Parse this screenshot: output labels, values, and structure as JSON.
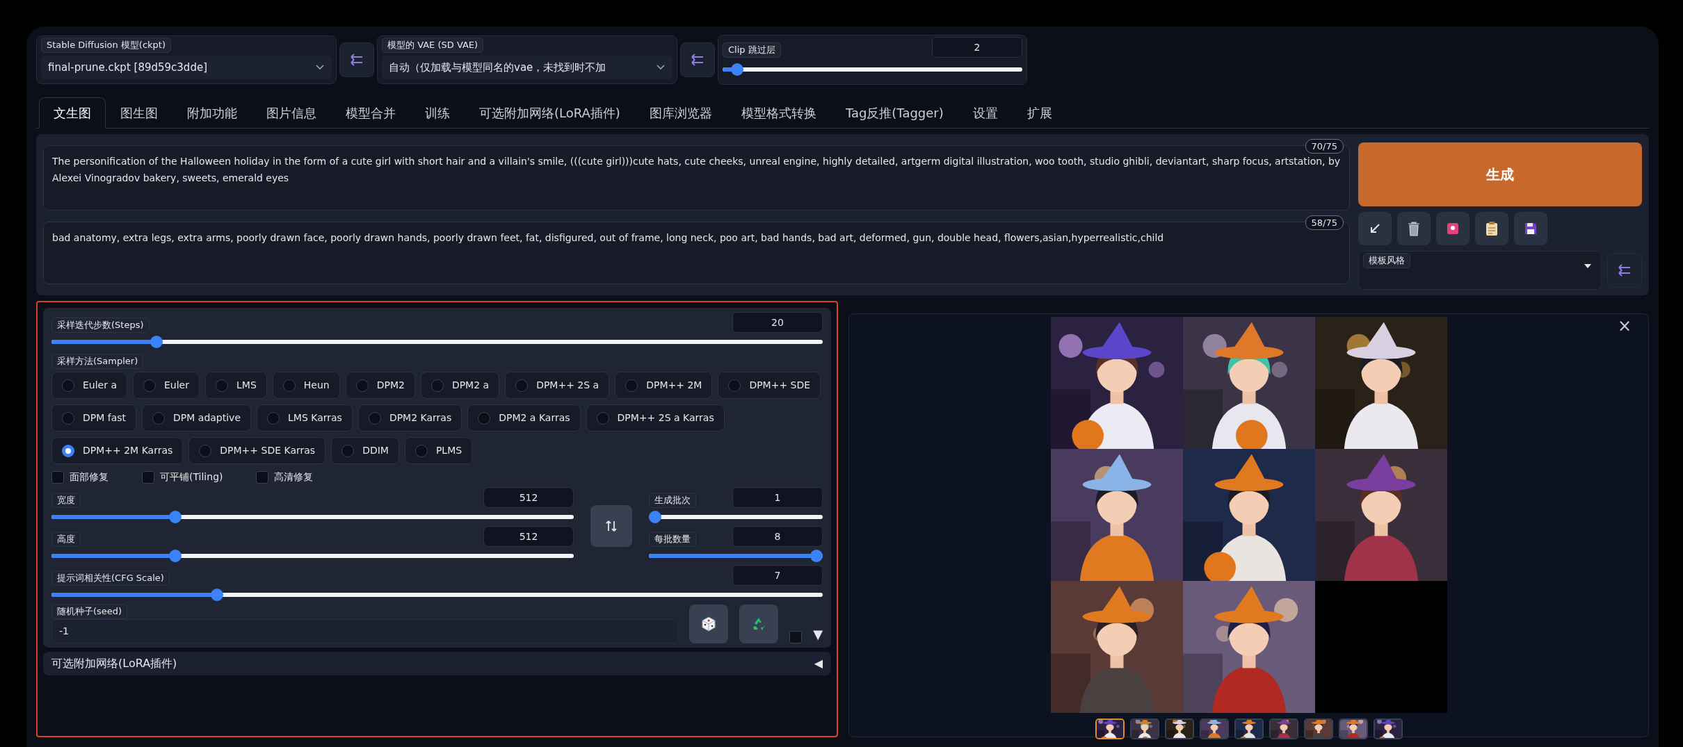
{
  "top_bar": {
    "checkpoint": {
      "label": "Stable Diffusion 模型(ckpt)",
      "value": "final-prune.ckpt [89d59c3dde]"
    },
    "vae": {
      "label": "模型的 VAE (SD VAE)",
      "value": "自动（仅加载与模型同名的vae，未找到时不加"
    },
    "clip_skip": {
      "label": "Clip 跳过层",
      "value": "2",
      "level": 0.03
    }
  },
  "tabs": [
    {
      "label": "文生图",
      "selected": true
    },
    {
      "label": "图生图",
      "selected": false
    },
    {
      "label": "附加功能",
      "selected": false
    },
    {
      "label": "图片信息",
      "selected": false
    },
    {
      "label": "模型合并",
      "selected": false
    },
    {
      "label": "训练",
      "selected": false
    },
    {
      "label": "可选附加网络(LoRA插件)",
      "selected": false
    },
    {
      "label": "图库浏览器",
      "selected": false
    },
    {
      "label": "模型格式转换",
      "selected": false
    },
    {
      "label": "Tag反推(Tagger)",
      "selected": false
    },
    {
      "label": "设置",
      "selected": false
    },
    {
      "label": "扩展",
      "selected": false
    }
  ],
  "prompt": {
    "text": "The personification of the Halloween holiday in the form of a cute girl with short hair and a villain's smile, (((cute girl)))cute hats, cute cheeks, unreal engine, highly detailed, artgerm digital illustration, woo tooth, studio ghibli, deviantart, sharp focus, artstation, by Alexei Vinogradov bakery, sweets, emerald eyes",
    "counter": "70/75"
  },
  "negative_prompt": {
    "text": "bad anatomy, extra legs, extra arms, poorly drawn face, poorly drawn hands, poorly drawn feet, fat, disfigured, out of frame, long neck, poo art, bad hands, bad art, deformed, gun, double head, flowers,asian,hyperrealistic,child",
    "counter": "58/75"
  },
  "generate_button": "生成",
  "styles": {
    "label": "模板风格"
  },
  "settings": {
    "steps": {
      "label": "采样迭代步数(Steps)",
      "value": "20",
      "level": 0.13
    },
    "sampler": {
      "label": "采样方法(Sampler)",
      "options": [
        {
          "label": "Euler a",
          "selected": false
        },
        {
          "label": "Euler",
          "selected": false
        },
        {
          "label": "LMS",
          "selected": false
        },
        {
          "label": "Heun",
          "selected": false
        },
        {
          "label": "DPM2",
          "selected": false
        },
        {
          "label": "DPM2 a",
          "selected": false
        },
        {
          "label": "DPM++ 2S a",
          "selected": false
        },
        {
          "label": "DPM++ 2M",
          "selected": false
        },
        {
          "label": "DPM++ SDE",
          "selected": false
        },
        {
          "label": "DPM fast",
          "selected": false
        },
        {
          "label": "DPM adaptive",
          "selected": false
        },
        {
          "label": "LMS Karras",
          "selected": false
        },
        {
          "label": "DPM2 Karras",
          "selected": false
        },
        {
          "label": "DPM2 a Karras",
          "selected": false
        },
        {
          "label": "DPM++ 2S a Karras",
          "selected": false
        },
        {
          "label": "DPM++ 2M Karras",
          "selected": true
        },
        {
          "label": "DPM++ SDE Karras",
          "selected": false
        },
        {
          "label": "DDIM",
          "selected": false
        },
        {
          "label": "PLMS",
          "selected": false
        }
      ]
    },
    "checkboxes": [
      {
        "label": "面部修复",
        "checked": false
      },
      {
        "label": "可平铺(Tiling)",
        "checked": false
      },
      {
        "label": "高清修复",
        "checked": false
      }
    ],
    "width": {
      "label": "宽度",
      "value": "512",
      "level": 0.23
    },
    "height": {
      "label": "高度",
      "value": "512",
      "level": 0.23
    },
    "batch_count": {
      "label": "生成批次",
      "value": "1",
      "level": 0
    },
    "batch_size": {
      "label": "每批数量",
      "value": "8",
      "level": 1
    },
    "cfg_scale": {
      "label": "提示词相关性(CFG Scale)",
      "value": "7",
      "level": 0.21
    },
    "seed": {
      "label": "随机种子(seed)",
      "value": "-1"
    },
    "extra": {
      "checked": false,
      "arrow": "▼"
    }
  },
  "lora": {
    "title": "可选附加网络(LoRA插件)",
    "expanded": false,
    "arrow": "◀"
  },
  "gallery": {
    "close": "×",
    "images": [
      {
        "kind": "picture"
      },
      {
        "kind": "picture"
      },
      {
        "kind": "picture"
      },
      {
        "kind": "picture"
      },
      {
        "kind": "picture"
      },
      {
        "kind": "picture"
      },
      {
        "kind": "picture"
      },
      {
        "kind": "picture"
      }
    ],
    "thumbnails": [
      {
        "kind": "picture",
        "selected": true
      },
      {
        "kind": "picture",
        "selected": false
      },
      {
        "kind": "picture",
        "selected": false
      },
      {
        "kind": "picture",
        "selected": false
      },
      {
        "kind": "picture",
        "selected": false
      },
      {
        "kind": "picture",
        "selected": false
      },
      {
        "kind": "picture",
        "selected": false
      },
      {
        "kind": "picture",
        "selected": false
      },
      {
        "kind": "picture",
        "selected": false
      }
    ]
  }
}
